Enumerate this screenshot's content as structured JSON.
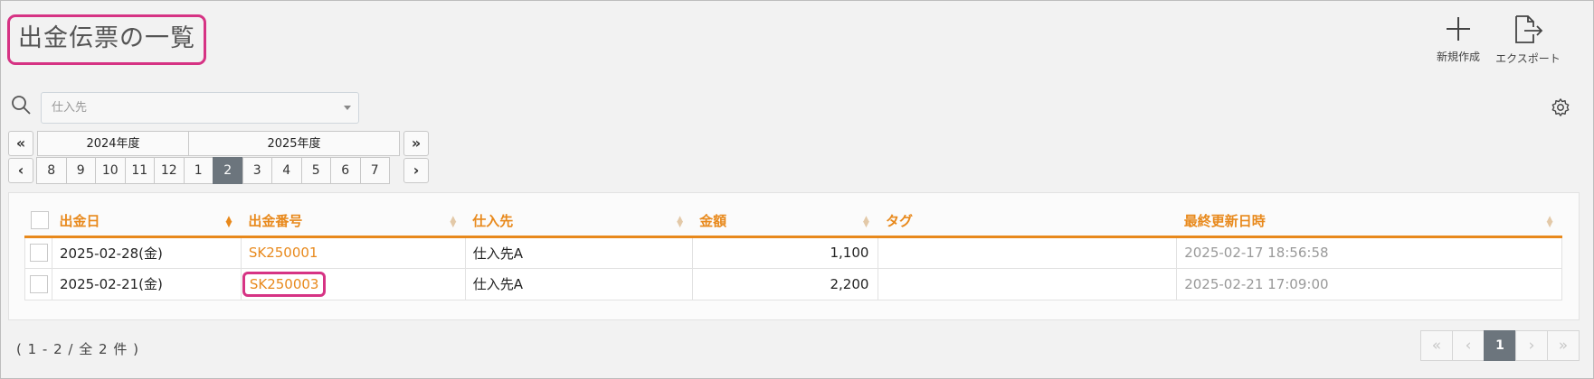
{
  "header": {
    "title": "出金伝票の一覧",
    "tools": [
      {
        "label": "新規作成",
        "icon": "plus-icon"
      },
      {
        "label": "エクスポート",
        "icon": "export-icon"
      }
    ]
  },
  "filter": {
    "supplier_placeholder": "仕入先"
  },
  "period": {
    "first_label": "«",
    "prev_label": "‹",
    "next_label": "›",
    "last_label": "»",
    "year_prev": "2024年度",
    "year_curr": "2025年度",
    "months": [
      "8",
      "9",
      "10",
      "11",
      "12",
      "1",
      "2",
      "3",
      "4",
      "5",
      "6",
      "7"
    ],
    "active_month": "2"
  },
  "table": {
    "columns": [
      "出金日",
      "出金番号",
      "仕入先",
      "金額",
      "タグ",
      "最終更新日時"
    ],
    "rows": [
      {
        "date": "2025-02-28(金)",
        "number": "SK250001",
        "supplier": "仕入先A",
        "amount": "1,100",
        "tag": "",
        "updated": "2025-02-17 18:56:58"
      },
      {
        "date": "2025-02-21(金)",
        "number": "SK250003",
        "supplier": "仕入先A",
        "amount": "2,200",
        "tag": "",
        "updated": "2025-02-21 17:09:00"
      }
    ]
  },
  "footer": {
    "count_text": "( 1 - 2 / 全 2 件 )",
    "pager": {
      "first": "«",
      "prev": "‹",
      "current": "1",
      "next": "›",
      "last": "»"
    }
  },
  "colors": {
    "accent": "#e8891c",
    "highlight": "#d63384",
    "active": "#6c757d"
  }
}
